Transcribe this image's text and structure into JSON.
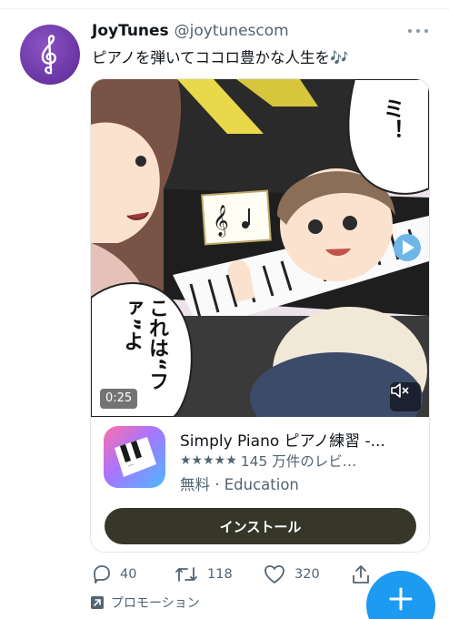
{
  "tweet": {
    "author_name": "JoyTunes",
    "author_handle": "@joytunescom",
    "text": "ピアノを弾いてココロ豊かな人生を🎶"
  },
  "media": {
    "duration": "0:25",
    "speech_right": "ミ！",
    "speech_left": "これは“ファ”よ"
  },
  "app_card": {
    "name": "Simply Piano ピアノ練習 -...",
    "stars": "★★★★★",
    "reviews": "145 万件のレビ…",
    "meta": "無料 · Education",
    "install_label": "インストール"
  },
  "actions": {
    "replies": "40",
    "retweets": "118",
    "likes": "320"
  },
  "promo_label": "プロモーション",
  "icons": {
    "avatar": "treble-clef-icon",
    "more": "more-icon",
    "mute": "speaker-mute-icon",
    "play": "play-icon",
    "reply": "reply-icon",
    "retweet": "retweet-icon",
    "like": "heart-icon",
    "share": "share-icon",
    "promoted": "promoted-arrow-icon",
    "compose": "plus-icon"
  },
  "colors": {
    "accent": "#1d9bf0",
    "install_button": "#363729",
    "secondary_text": "#536471",
    "avatar": "#6a35a3"
  }
}
